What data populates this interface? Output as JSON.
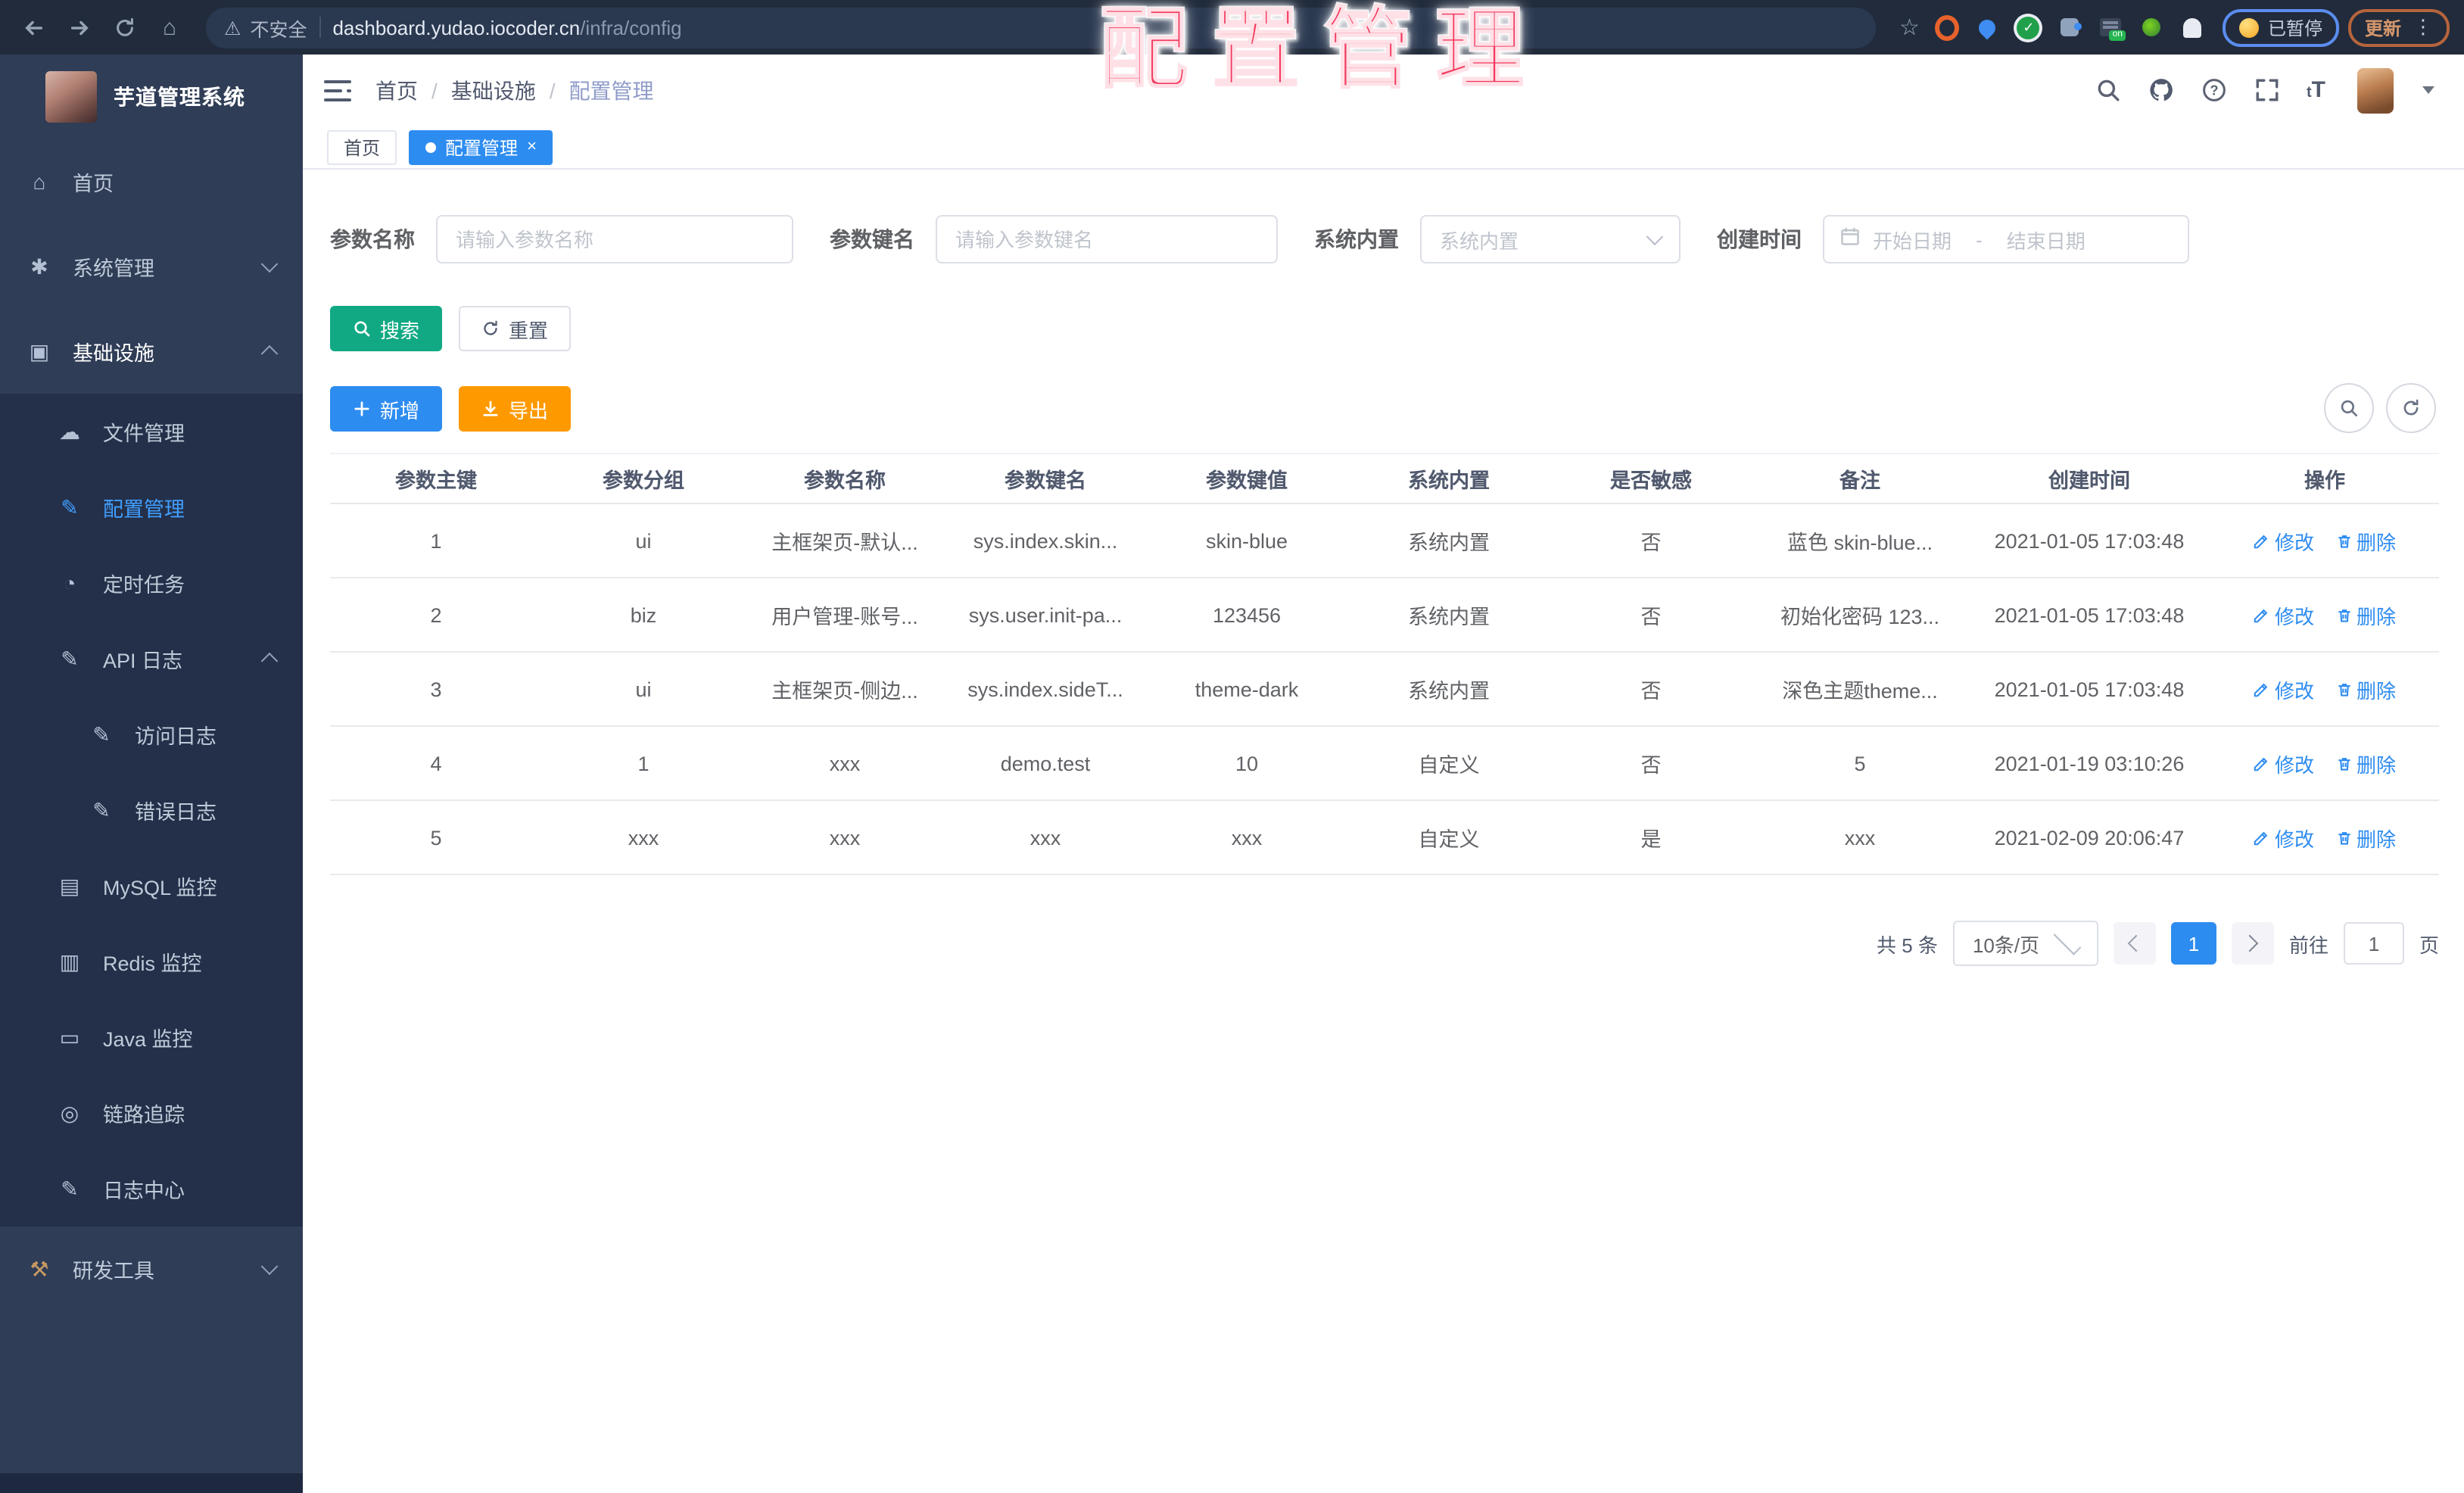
{
  "browser": {
    "security_label": "不安全",
    "url_host": "dashboard.yudao.iocoder.cn",
    "url_path": "/infra/config",
    "paused_label": "已暂停",
    "update_label": "更新"
  },
  "watermark": "配置管理",
  "colors": {
    "accent_blue": "#2d8cf0",
    "search_teal": "#11a983",
    "export_orange": "#ff9900",
    "watermark_red": "#f43a5f",
    "sidebar_bg": "#2f3d57",
    "sidebar_submenu_bg": "#243049",
    "active_menu_blue": "#409eff"
  },
  "icons": {
    "home": "⌂",
    "gear": "✱",
    "infra": "▣",
    "cloud": "☁",
    "edit": "✎",
    "timer": "◔",
    "log": "✎",
    "database": "▤",
    "redis": "▥",
    "java": "▭",
    "trace": "◎",
    "log-center": "✎",
    "toolbox": "⚒"
  },
  "sidebar": {
    "app_title": "芋道管理系统",
    "items": [
      {
        "label": "首页",
        "icon": "home",
        "level": 1
      },
      {
        "label": "系统管理",
        "icon": "gear",
        "level": 1,
        "chevron": "down"
      },
      {
        "label": "基础设施",
        "icon": "infra",
        "level": 1,
        "chevron": "up",
        "open": true
      },
      {
        "label": "文件管理",
        "icon": "cloud",
        "level": 2,
        "group": true
      },
      {
        "label": "配置管理",
        "icon": "edit",
        "level": 2,
        "group": true,
        "active": true
      },
      {
        "label": "定时任务",
        "icon": "timer",
        "level": 2,
        "group": true
      },
      {
        "label": "API 日志",
        "icon": "log",
        "level": 2,
        "group": true,
        "chevron": "up"
      },
      {
        "label": "访问日志",
        "icon": "log",
        "level": 3,
        "group": true
      },
      {
        "label": "错误日志",
        "icon": "log",
        "level": 3,
        "group": true
      },
      {
        "label": "MySQL 监控",
        "icon": "database",
        "level": 2,
        "group": true
      },
      {
        "label": "Redis 监控",
        "icon": "redis",
        "level": 2,
        "group": true
      },
      {
        "label": "Java 监控",
        "icon": "java",
        "level": 2,
        "group": true
      },
      {
        "label": "链路追踪",
        "icon": "trace",
        "level": 2,
        "group": true
      },
      {
        "label": "日志中心",
        "icon": "log-center",
        "level": 2,
        "group": true
      },
      {
        "label": "研发工具",
        "icon": "toolbox",
        "level": 1,
        "chevron": "down"
      }
    ]
  },
  "header": {
    "breadcrumb": [
      "首页",
      "基础设施",
      "配置管理"
    ]
  },
  "tabs": [
    {
      "label": "首页",
      "active": false
    },
    {
      "label": "配置管理",
      "active": true,
      "closable": true
    }
  ],
  "filters": {
    "name_label": "参数名称",
    "name_placeholder": "请输入参数名称",
    "key_label": "参数键名",
    "key_placeholder": "请输入参数键名",
    "type_label": "系统内置",
    "type_placeholder": "系统内置",
    "date_label": "创建时间",
    "date_start": "开始日期",
    "date_sep": "-",
    "date_end": "结束日期"
  },
  "actions": {
    "search": "搜索",
    "reset": "重置",
    "add": "新增",
    "export": "导出"
  },
  "table": {
    "headers": [
      "参数主键",
      "参数分组",
      "参数名称",
      "参数键名",
      "参数键值",
      "系统内置",
      "是否敏感",
      "备注",
      "创建时间",
      "操作"
    ],
    "edit_label": "修改",
    "delete_label": "删除",
    "rows": [
      {
        "cells": [
          "1",
          "ui",
          "主框架页-默认...",
          "sys.index.skin...",
          "skin-blue",
          "系统内置",
          "否",
          "蓝色 skin-blue...",
          "2021-01-05 17:03:48"
        ]
      },
      {
        "cells": [
          "2",
          "biz",
          "用户管理-账号...",
          "sys.user.init-pa...",
          "123456",
          "系统内置",
          "否",
          "初始化密码 123...",
          "2021-01-05 17:03:48"
        ]
      },
      {
        "cells": [
          "3",
          "ui",
          "主框架页-侧边...",
          "sys.index.sideT...",
          "theme-dark",
          "系统内置",
          "否",
          "深色主题theme...",
          "2021-01-05 17:03:48"
        ]
      },
      {
        "cells": [
          "4",
          "1",
          "xxx",
          "demo.test",
          "10",
          "自定义",
          "否",
          "5",
          "2021-01-19 03:10:26"
        ]
      },
      {
        "cells": [
          "5",
          "xxx",
          "xxx",
          "xxx",
          "xxx",
          "自定义",
          "是",
          "xxx",
          "2021-02-09 20:06:47"
        ]
      }
    ]
  },
  "pagination": {
    "total": "共 5 条",
    "page_size": "10条/页",
    "current": "1",
    "goto_label": "前往",
    "goto_value": "1",
    "unit": "页"
  }
}
